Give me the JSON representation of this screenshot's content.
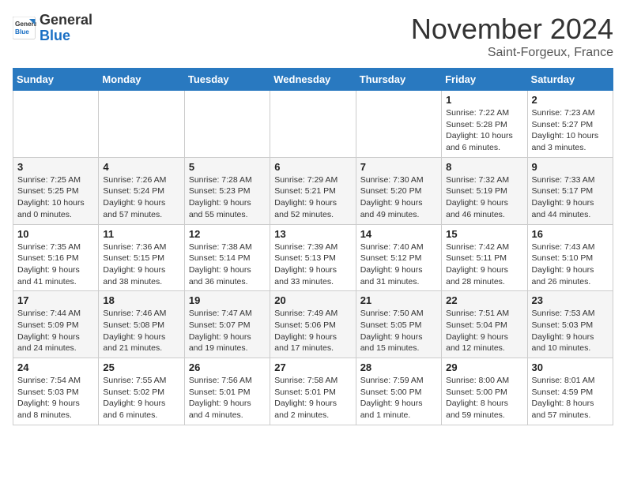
{
  "logo": {
    "line1": "General",
    "line2": "Blue"
  },
  "header": {
    "month": "November 2024",
    "location": "Saint-Forgeux, France"
  },
  "weekdays": [
    "Sunday",
    "Monday",
    "Tuesday",
    "Wednesday",
    "Thursday",
    "Friday",
    "Saturday"
  ],
  "weeks": [
    [
      {
        "day": "",
        "info": ""
      },
      {
        "day": "",
        "info": ""
      },
      {
        "day": "",
        "info": ""
      },
      {
        "day": "",
        "info": ""
      },
      {
        "day": "",
        "info": ""
      },
      {
        "day": "1",
        "info": "Sunrise: 7:22 AM\nSunset: 5:28 PM\nDaylight: 10 hours and 6 minutes."
      },
      {
        "day": "2",
        "info": "Sunrise: 7:23 AM\nSunset: 5:27 PM\nDaylight: 10 hours and 3 minutes."
      }
    ],
    [
      {
        "day": "3",
        "info": "Sunrise: 7:25 AM\nSunset: 5:25 PM\nDaylight: 10 hours and 0 minutes."
      },
      {
        "day": "4",
        "info": "Sunrise: 7:26 AM\nSunset: 5:24 PM\nDaylight: 9 hours and 57 minutes."
      },
      {
        "day": "5",
        "info": "Sunrise: 7:28 AM\nSunset: 5:23 PM\nDaylight: 9 hours and 55 minutes."
      },
      {
        "day": "6",
        "info": "Sunrise: 7:29 AM\nSunset: 5:21 PM\nDaylight: 9 hours and 52 minutes."
      },
      {
        "day": "7",
        "info": "Sunrise: 7:30 AM\nSunset: 5:20 PM\nDaylight: 9 hours and 49 minutes."
      },
      {
        "day": "8",
        "info": "Sunrise: 7:32 AM\nSunset: 5:19 PM\nDaylight: 9 hours and 46 minutes."
      },
      {
        "day": "9",
        "info": "Sunrise: 7:33 AM\nSunset: 5:17 PM\nDaylight: 9 hours and 44 minutes."
      }
    ],
    [
      {
        "day": "10",
        "info": "Sunrise: 7:35 AM\nSunset: 5:16 PM\nDaylight: 9 hours and 41 minutes."
      },
      {
        "day": "11",
        "info": "Sunrise: 7:36 AM\nSunset: 5:15 PM\nDaylight: 9 hours and 38 minutes."
      },
      {
        "day": "12",
        "info": "Sunrise: 7:38 AM\nSunset: 5:14 PM\nDaylight: 9 hours and 36 minutes."
      },
      {
        "day": "13",
        "info": "Sunrise: 7:39 AM\nSunset: 5:13 PM\nDaylight: 9 hours and 33 minutes."
      },
      {
        "day": "14",
        "info": "Sunrise: 7:40 AM\nSunset: 5:12 PM\nDaylight: 9 hours and 31 minutes."
      },
      {
        "day": "15",
        "info": "Sunrise: 7:42 AM\nSunset: 5:11 PM\nDaylight: 9 hours and 28 minutes."
      },
      {
        "day": "16",
        "info": "Sunrise: 7:43 AM\nSunset: 5:10 PM\nDaylight: 9 hours and 26 minutes."
      }
    ],
    [
      {
        "day": "17",
        "info": "Sunrise: 7:44 AM\nSunset: 5:09 PM\nDaylight: 9 hours and 24 minutes."
      },
      {
        "day": "18",
        "info": "Sunrise: 7:46 AM\nSunset: 5:08 PM\nDaylight: 9 hours and 21 minutes."
      },
      {
        "day": "19",
        "info": "Sunrise: 7:47 AM\nSunset: 5:07 PM\nDaylight: 9 hours and 19 minutes."
      },
      {
        "day": "20",
        "info": "Sunrise: 7:49 AM\nSunset: 5:06 PM\nDaylight: 9 hours and 17 minutes."
      },
      {
        "day": "21",
        "info": "Sunrise: 7:50 AM\nSunset: 5:05 PM\nDaylight: 9 hours and 15 minutes."
      },
      {
        "day": "22",
        "info": "Sunrise: 7:51 AM\nSunset: 5:04 PM\nDaylight: 9 hours and 12 minutes."
      },
      {
        "day": "23",
        "info": "Sunrise: 7:53 AM\nSunset: 5:03 PM\nDaylight: 9 hours and 10 minutes."
      }
    ],
    [
      {
        "day": "24",
        "info": "Sunrise: 7:54 AM\nSunset: 5:03 PM\nDaylight: 9 hours and 8 minutes."
      },
      {
        "day": "25",
        "info": "Sunrise: 7:55 AM\nSunset: 5:02 PM\nDaylight: 9 hours and 6 minutes."
      },
      {
        "day": "26",
        "info": "Sunrise: 7:56 AM\nSunset: 5:01 PM\nDaylight: 9 hours and 4 minutes."
      },
      {
        "day": "27",
        "info": "Sunrise: 7:58 AM\nSunset: 5:01 PM\nDaylight: 9 hours and 2 minutes."
      },
      {
        "day": "28",
        "info": "Sunrise: 7:59 AM\nSunset: 5:00 PM\nDaylight: 9 hours and 1 minute."
      },
      {
        "day": "29",
        "info": "Sunrise: 8:00 AM\nSunset: 5:00 PM\nDaylight: 8 hours and 59 minutes."
      },
      {
        "day": "30",
        "info": "Sunrise: 8:01 AM\nSunset: 4:59 PM\nDaylight: 8 hours and 57 minutes."
      }
    ]
  ]
}
